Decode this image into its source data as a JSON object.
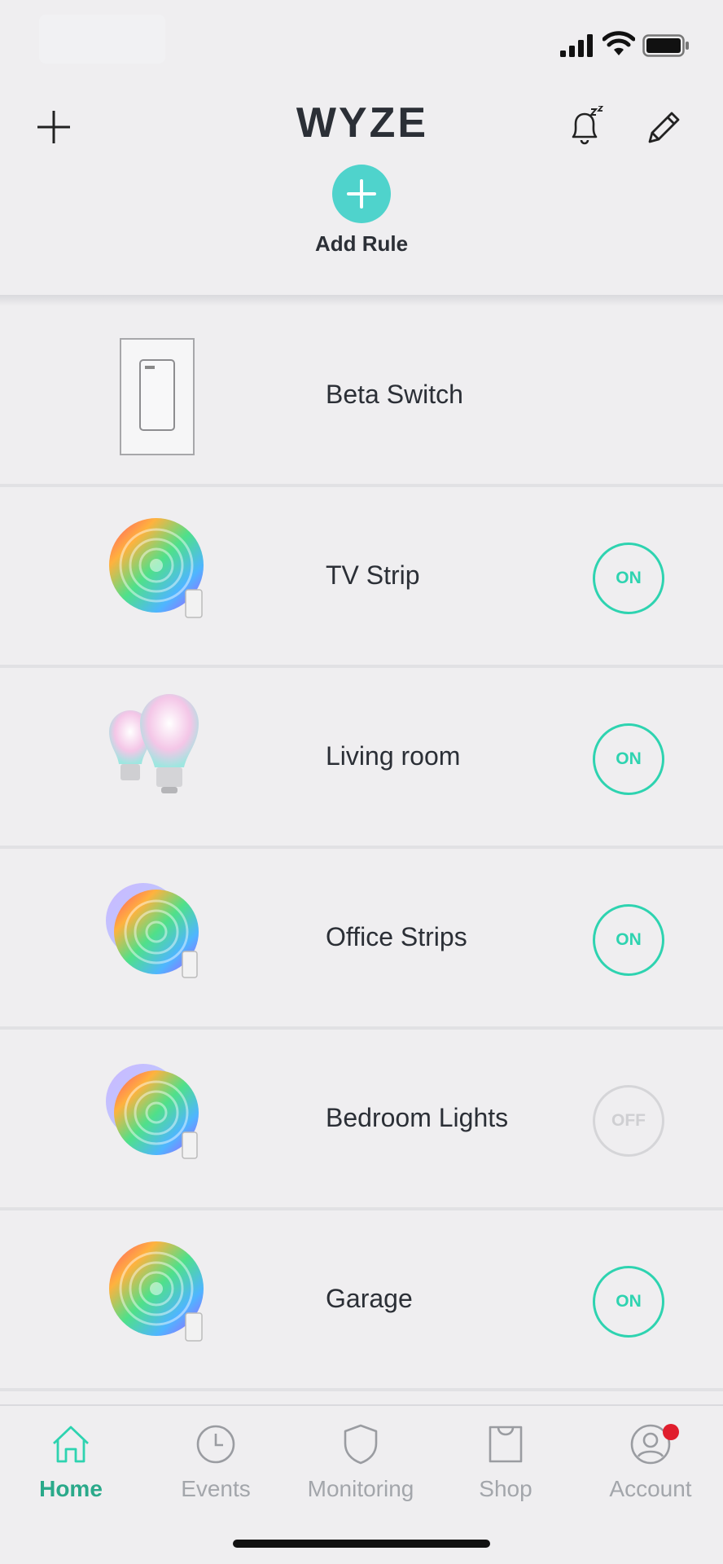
{
  "header": {
    "logo_text": "WYZE",
    "add_rule_label": "Add Rule"
  },
  "devices": [
    {
      "name": "Beta Switch",
      "kind": "switch",
      "toggle": null
    },
    {
      "name": "TV Strip",
      "kind": "lightstrip",
      "toggle": "ON"
    },
    {
      "name": "Living room",
      "kind": "bulbs",
      "toggle": "ON"
    },
    {
      "name": "Office Strips",
      "kind": "lightstrip-group",
      "toggle": "ON"
    },
    {
      "name": "Bedroom Lights",
      "kind": "lightstrip-group",
      "toggle": "OFF"
    },
    {
      "name": "Garage",
      "kind": "lightstrip",
      "toggle": "ON"
    }
  ],
  "tabs": [
    {
      "label": "Home",
      "icon": "home-icon",
      "active": true
    },
    {
      "label": "Events",
      "icon": "clock-icon",
      "active": false
    },
    {
      "label": "Monitoring",
      "icon": "shield-icon",
      "active": false
    },
    {
      "label": "Shop",
      "icon": "shopping-bag-icon",
      "active": false
    },
    {
      "label": "Account",
      "icon": "account-icon",
      "active": false
    }
  ],
  "colors": {
    "accent": "#2ed3b0",
    "add_rule": "#4fd3cc",
    "active_tab": "#2aa98a",
    "badge": "#e01e2d"
  }
}
